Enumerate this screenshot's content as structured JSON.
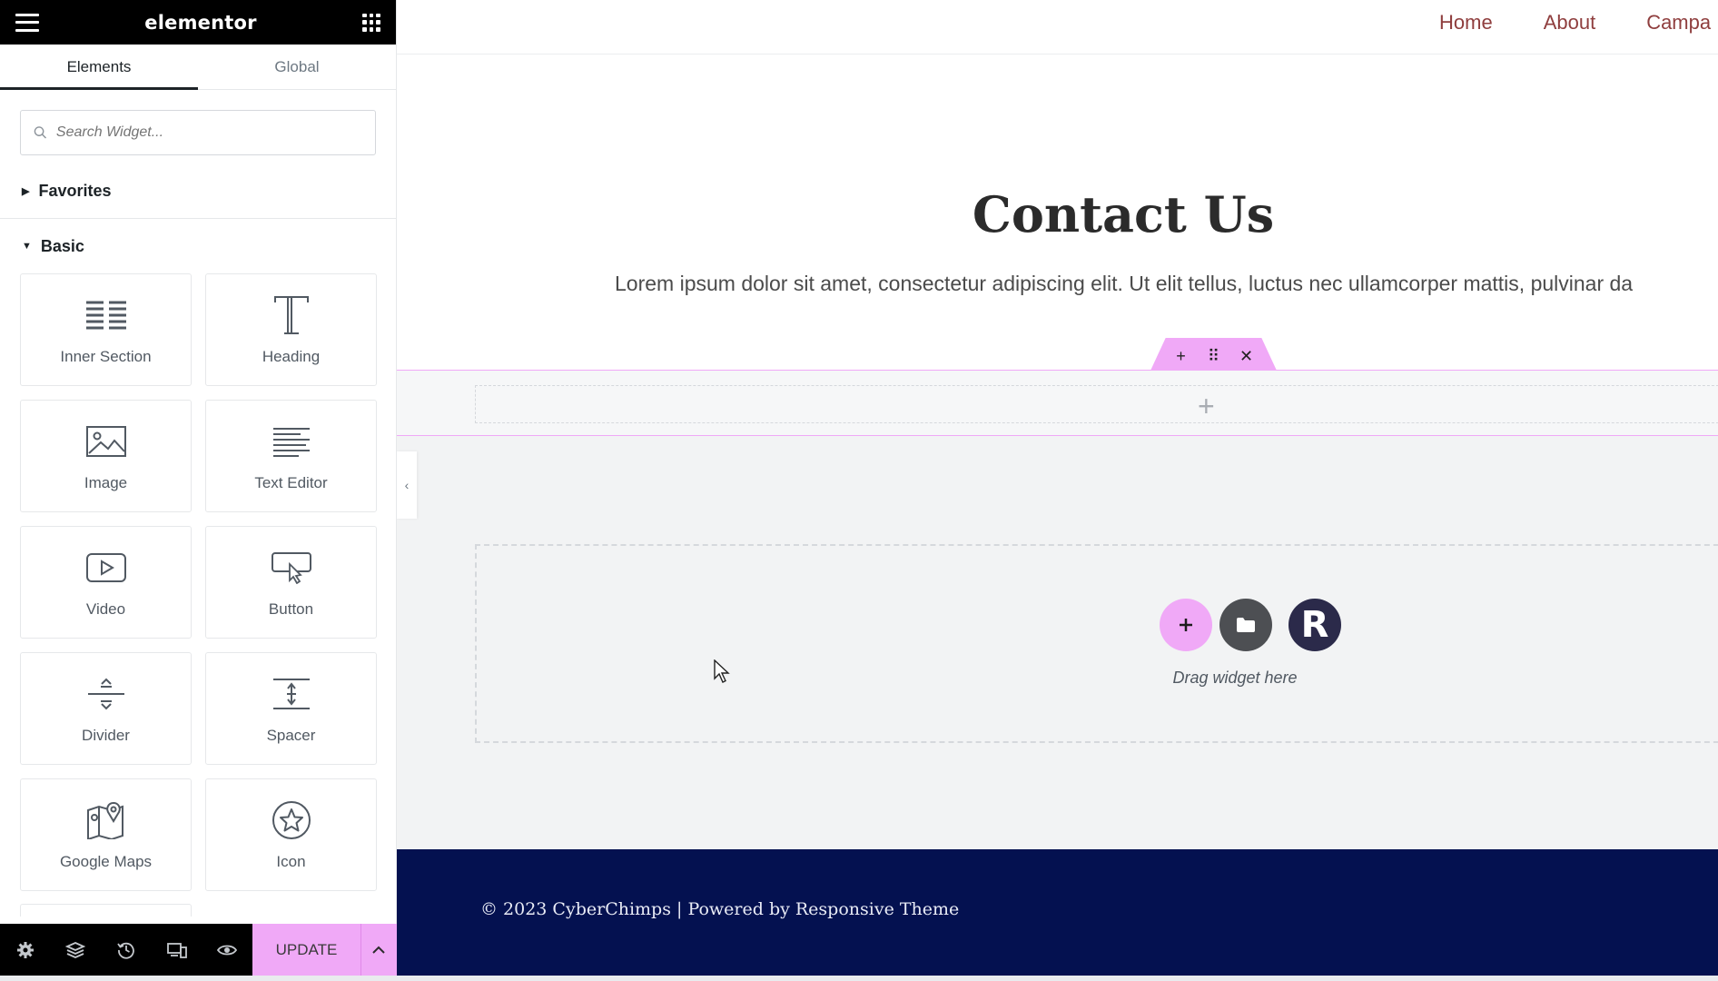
{
  "app": {
    "logo_text": "elementor"
  },
  "panel": {
    "tabs": [
      {
        "label": "Elements",
        "active": true
      },
      {
        "label": "Global",
        "active": false
      }
    ],
    "search": {
      "placeholder": "Search Widget...",
      "value": ""
    },
    "categories": {
      "favorites": {
        "label": "Favorites",
        "expanded": false
      },
      "basic": {
        "label": "Basic",
        "expanded": true
      }
    },
    "widgets": [
      {
        "label": "Inner Section",
        "icon": "inner-section-icon"
      },
      {
        "label": "Heading",
        "icon": "heading-icon"
      },
      {
        "label": "Image",
        "icon": "image-icon"
      },
      {
        "label": "Text Editor",
        "icon": "text-editor-icon"
      },
      {
        "label": "Video",
        "icon": "video-icon"
      },
      {
        "label": "Button",
        "icon": "button-icon"
      },
      {
        "label": "Divider",
        "icon": "divider-icon"
      },
      {
        "label": "Spacer",
        "icon": "spacer-icon"
      },
      {
        "label": "Google Maps",
        "icon": "google-maps-icon"
      },
      {
        "label": "Icon",
        "icon": "star-icon"
      }
    ],
    "footer": {
      "icons": [
        "settings-icon",
        "navigator-layers-icon",
        "history-icon",
        "responsive-mode-icon",
        "preview-eye-icon"
      ],
      "update_label": "UPDATE"
    }
  },
  "site": {
    "nav": [
      "Home",
      "About",
      "Campa"
    ],
    "heading": "Contact Us",
    "paragraph": "Lorem ipsum dolor sit amet, consectetur adipiscing elit. Ut elit tellus, luctus nec ullamcorper mattis, pulvinar da",
    "drop_zone_text": "Drag widget here",
    "drop_zone_r_label": "R",
    "footer_text": "© 2023 CyberChimps | Powered by Responsive Theme"
  },
  "colors": {
    "accent_pink": "#f0a9f7",
    "nav_link": "#8f3e3e",
    "footer_bg": "#041150",
    "topbar_bg": "#000000"
  }
}
